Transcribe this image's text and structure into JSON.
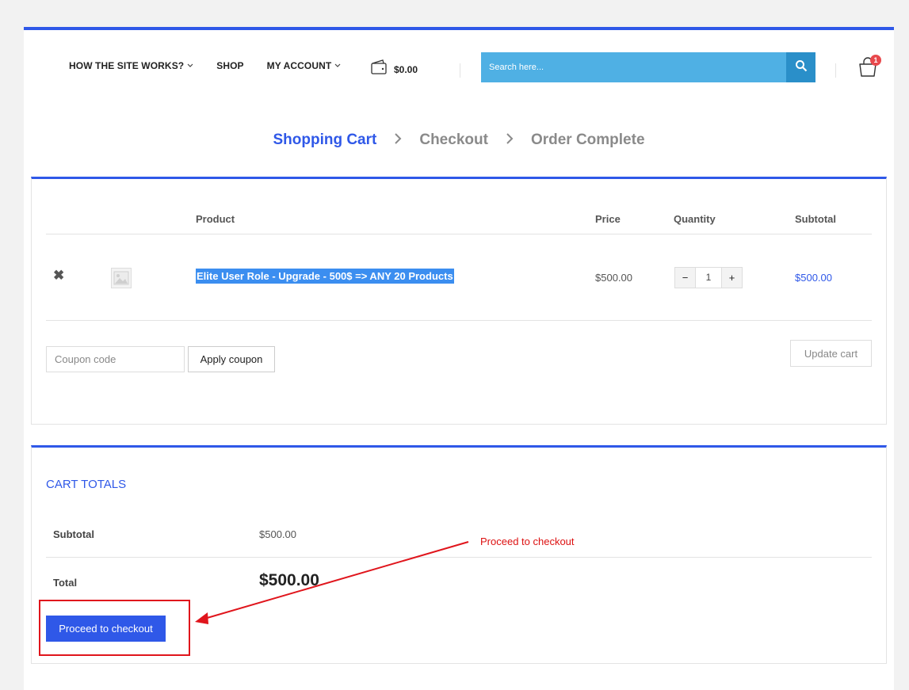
{
  "header": {
    "nav": [
      {
        "label": "HOW THE SITE WORKS?",
        "has_dropdown": true
      },
      {
        "label": "SHOP",
        "has_dropdown": false
      },
      {
        "label": "MY ACCOUNT",
        "has_dropdown": true
      }
    ],
    "wallet_amount": "$0.00",
    "search_placeholder": "Search here...",
    "cart_count": "1"
  },
  "steps": {
    "items": [
      "Shopping Cart",
      "Checkout",
      "Order Complete"
    ],
    "active": 0
  },
  "cart": {
    "headers": {
      "product": "Product",
      "price": "Price",
      "quantity": "Quantity",
      "subtotal": "Subtotal"
    },
    "items": [
      {
        "name": "Elite User Role - Upgrade - 500$ => ANY 20 Products",
        "price": "$500.00",
        "quantity": "1",
        "subtotal": "$500.00"
      }
    ],
    "coupon_placeholder": "Coupon code",
    "apply_coupon_label": "Apply coupon",
    "update_cart_label": "Update cart"
  },
  "totals": {
    "title": "CART TOTALS",
    "subtotal_label": "Subtotal",
    "subtotal_value": "$500.00",
    "total_label": "Total",
    "total_value": "$500.00",
    "checkout_label": "Proceed to checkout"
  },
  "annotation": {
    "text": "Proceed to checkout",
    "color": "#e0151c"
  },
  "colors": {
    "accent": "#2f58e8",
    "search_bg": "#4fb0e4",
    "search_button": "#2a8fc9",
    "badge": "#e8484c"
  }
}
